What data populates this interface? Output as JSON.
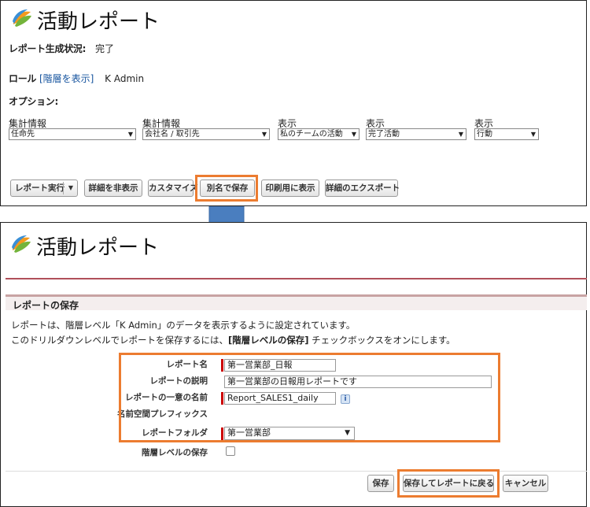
{
  "top": {
    "title": "活動レポート",
    "status_label": "レポート生成状況:",
    "status_value": "完了",
    "role_label": "ロール",
    "role_link": "[階層を表示]",
    "role_value": "K Admin",
    "options_label": "オプション:",
    "filters": [
      {
        "label": "集計情報",
        "value": "任命先"
      },
      {
        "label": "集計情報",
        "value": "会社名 / 取引先"
      },
      {
        "label": "表示",
        "value": "私のチームの活動"
      },
      {
        "label": "表示",
        "value": "完了活動"
      },
      {
        "label": "表示",
        "value": "行動"
      }
    ],
    "buttons": {
      "run": "レポート実行",
      "hide_details": "詳細を非表示",
      "customize": "カスタマイズ",
      "save_as": "別名で保存",
      "printable": "印刷用に表示",
      "export": "詳細のエクスポート"
    }
  },
  "bottom": {
    "title": "活動レポート",
    "section_title": "レポートの保存",
    "desc1": "レポートは、階層レベル「K Admin」のデータを表示するように設定されています。",
    "desc2_pre": "このドリルダウンレベルでレポートを保存するには、",
    "desc2_bold": "[階層レベルの保存]",
    "desc2_post": " チェックボックスをオンにします。",
    "fields": {
      "name_label": "レポート名",
      "name_value": "第一営業部_日報",
      "desc_label": "レポートの説明",
      "desc_value": "第一営業部の日報用レポートです",
      "unique_label": "レポートの一意の名前",
      "unique_value": "Report_SALES1_daily",
      "namespace_label": "名前空間プレフィックス",
      "folder_label": "レポートフォルダ",
      "folder_value": "第一営業部",
      "hierarchy_label": "階層レベルの保存"
    },
    "buttons": {
      "save": "保存",
      "save_return": "保存してレポートに戻る",
      "cancel": "キャンセル"
    }
  },
  "colors": {
    "highlight": "#ec7c30",
    "arrow": "#4a7ebf",
    "link": "#15539e"
  },
  "icons": [
    "app-logo-icon",
    "down-arrow-icon",
    "info-icon",
    "dropdown-caret-icon"
  ]
}
